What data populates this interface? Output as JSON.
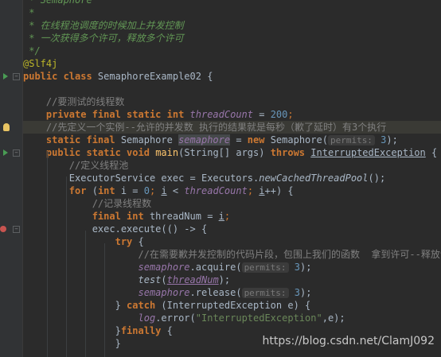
{
  "editor": {
    "lines": [
      {
        "parts": [
          {
            "t": " * ",
            "c": "c-doc"
          },
          {
            "t": "Semaphore",
            "c": "c-doc"
          }
        ]
      },
      {
        "parts": [
          {
            "t": " *",
            "c": "c-doc"
          }
        ]
      },
      {
        "parts": [
          {
            "t": " * 在线程池调度的时候加上并发控制",
            "c": "c-doc"
          }
        ]
      },
      {
        "parts": [
          {
            "t": " * 一次获得多个许可，释放多个许可",
            "c": "c-doc"
          }
        ]
      },
      {
        "parts": [
          {
            "t": " */",
            "c": "c-doc"
          }
        ]
      },
      {
        "parts": [
          {
            "t": "@Slf4j",
            "c": "c-ann"
          }
        ]
      },
      {
        "parts": [
          {
            "t": "public class ",
            "c": "c-kw"
          },
          {
            "t": "SemaphoreExample02 {",
            "c": ""
          }
        ]
      },
      {
        "parts": [
          {
            "t": "",
            "c": ""
          }
        ]
      },
      {
        "parts": [
          {
            "t": "    ",
            "c": ""
          },
          {
            "t": "//要测试的线程数",
            "c": "c-cmt"
          }
        ]
      },
      {
        "parts": [
          {
            "t": "    ",
            "c": ""
          },
          {
            "t": "private final static int ",
            "c": "c-kw"
          },
          {
            "t": "threadCount",
            "c": "c-field"
          },
          {
            "t": " = ",
            "c": ""
          },
          {
            "t": "200",
            "c": "c-num"
          },
          {
            "t": ";",
            "c": "c-kw2"
          }
        ]
      },
      {
        "parts": [
          {
            "t": "    ",
            "c": ""
          },
          {
            "t": "//先定义一个实例--允许的并发数 执行的结果就是每秒（歉了延时）有3个执行",
            "c": "c-cmt"
          }
        ],
        "hl": true
      },
      {
        "parts": [
          {
            "t": "    ",
            "c": ""
          },
          {
            "t": "static final ",
            "c": "c-kw"
          },
          {
            "t": "Semaphore ",
            "c": ""
          },
          {
            "t": "semaphore",
            "c": "c-warnbox"
          },
          {
            "t": " = ",
            "c": ""
          },
          {
            "t": "new ",
            "c": "c-kw"
          },
          {
            "t": "Semaphore(",
            "c": ""
          },
          {
            "t": "permits:",
            "c": "hint"
          },
          {
            "t": " ",
            "c": ""
          },
          {
            "t": "3",
            "c": "c-num"
          },
          {
            "t": ");",
            "c": ""
          }
        ]
      },
      {
        "parts": [
          {
            "t": "    ",
            "c": ""
          },
          {
            "t": "public static void ",
            "c": "c-kw"
          },
          {
            "t": "main",
            "c": "c-fn"
          },
          {
            "t": "(String[] args) ",
            "c": ""
          },
          {
            "t": "throws ",
            "c": "c-kw"
          },
          {
            "t": "InterruptedException",
            "c": "c-under"
          },
          {
            "t": " {",
            "c": ""
          }
        ]
      },
      {
        "parts": [
          {
            "t": "        ",
            "c": ""
          },
          {
            "t": "//定义线程池",
            "c": "c-cmt"
          }
        ]
      },
      {
        "parts": [
          {
            "t": "        ExecutorService exec = Executors.",
            "c": ""
          },
          {
            "t": "newCachedThreadPool",
            "c": "c-static"
          },
          {
            "t": "();",
            "c": ""
          }
        ]
      },
      {
        "parts": [
          {
            "t": "        ",
            "c": ""
          },
          {
            "t": "for ",
            "c": "c-kw"
          },
          {
            "t": "(",
            "c": ""
          },
          {
            "t": "int ",
            "c": "c-kw"
          },
          {
            "t": "i = ",
            "c": ""
          },
          {
            "t": "0",
            "c": "c-num"
          },
          {
            "t": "; ",
            "c": "c-kw2"
          },
          {
            "t": "i",
            "c": "c-under"
          },
          {
            "t": " < ",
            "c": ""
          },
          {
            "t": "threadCount",
            "c": "c-field"
          },
          {
            "t": "; ",
            "c": "c-kw2"
          },
          {
            "t": "i",
            "c": "c-under"
          },
          {
            "t": "++) {",
            "c": ""
          }
        ]
      },
      {
        "parts": [
          {
            "t": "            ",
            "c": ""
          },
          {
            "t": "//记录线程数",
            "c": "c-cmt"
          }
        ]
      },
      {
        "parts": [
          {
            "t": "            ",
            "c": ""
          },
          {
            "t": "final int ",
            "c": "c-kw"
          },
          {
            "t": "threadNum = ",
            "c": ""
          },
          {
            "t": "i",
            "c": "c-under"
          },
          {
            "t": ";",
            "c": "c-kw2"
          }
        ]
      },
      {
        "parts": [
          {
            "t": "            exec.execute(() -> {",
            "c": ""
          }
        ]
      },
      {
        "parts": [
          {
            "t": "                ",
            "c": ""
          },
          {
            "t": "try ",
            "c": "c-kw"
          },
          {
            "t": "{",
            "c": ""
          }
        ]
      },
      {
        "parts": [
          {
            "t": "                    ",
            "c": ""
          },
          {
            "t": "//在需要歉并发控制的代码片段，包围上我们的函数  拿到许可--释放许可",
            "c": "c-cmt"
          }
        ]
      },
      {
        "parts": [
          {
            "t": "                    ",
            "c": ""
          },
          {
            "t": "semaphore",
            "c": "c-field"
          },
          {
            "t": ".acquire(",
            "c": ""
          },
          {
            "t": "permits:",
            "c": "hint"
          },
          {
            "t": " ",
            "c": ""
          },
          {
            "t": "3",
            "c": "c-num"
          },
          {
            "t": ");",
            "c": ""
          }
        ]
      },
      {
        "parts": [
          {
            "t": "                    ",
            "c": ""
          },
          {
            "t": "test",
            "c": "c-static"
          },
          {
            "t": "(",
            "c": ""
          },
          {
            "t": "threadNum",
            "c": "c-field c-under"
          },
          {
            "t": ");",
            "c": ""
          }
        ]
      },
      {
        "parts": [
          {
            "t": "                    ",
            "c": ""
          },
          {
            "t": "semaphore",
            "c": "c-field"
          },
          {
            "t": ".release(",
            "c": ""
          },
          {
            "t": "permits:",
            "c": "hint"
          },
          {
            "t": " ",
            "c": ""
          },
          {
            "t": "3",
            "c": "c-num"
          },
          {
            "t": ");",
            "c": ""
          }
        ]
      },
      {
        "parts": [
          {
            "t": "                } ",
            "c": ""
          },
          {
            "t": "catch ",
            "c": "c-kw"
          },
          {
            "t": "(InterruptedException e) {",
            "c": ""
          }
        ]
      },
      {
        "parts": [
          {
            "t": "                    ",
            "c": ""
          },
          {
            "t": "log",
            "c": "c-field"
          },
          {
            "t": ".error(",
            "c": ""
          },
          {
            "t": "\"InterruptedException\"",
            "c": "c-str"
          },
          {
            "t": ",e);",
            "c": ""
          }
        ]
      },
      {
        "parts": [
          {
            "t": "                }",
            "c": ""
          },
          {
            "t": "finally ",
            "c": "c-kw"
          },
          {
            "t": "{",
            "c": ""
          }
        ]
      },
      {
        "parts": [
          {
            "t": "                }",
            "c": ""
          }
        ]
      }
    ]
  },
  "gutter": {
    "marks": [
      {
        "line": 6,
        "type": "run"
      },
      {
        "line": 6,
        "type": "fold"
      },
      {
        "line": 10,
        "type": "bulb"
      },
      {
        "line": 12,
        "type": "run"
      },
      {
        "line": 12,
        "type": "fold"
      },
      {
        "line": 18,
        "type": "breakpoint"
      },
      {
        "line": 18,
        "type": "fold"
      }
    ]
  },
  "watermark": "https://blog.csdn.net/ClamJ092"
}
